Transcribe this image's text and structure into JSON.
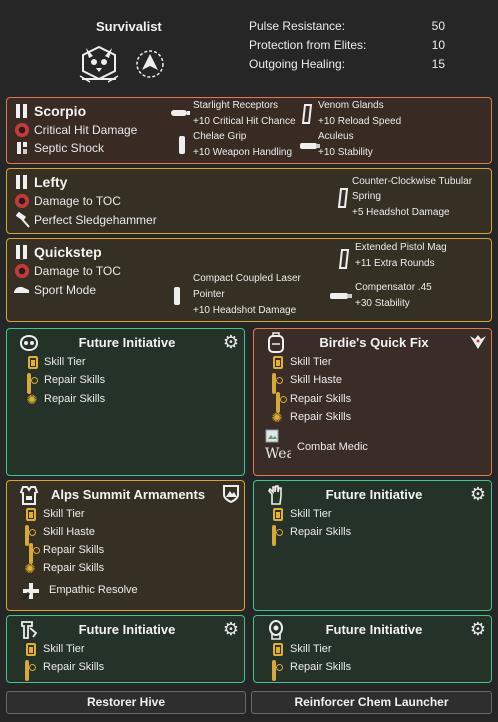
{
  "header": {
    "class_name": "Survivalist",
    "stats": [
      {
        "label": "Pulse Resistance:",
        "value": "50"
      },
      {
        "label": "Protection from Elites:",
        "value": "10"
      },
      {
        "label": "Outgoing Healing:",
        "value": "15"
      }
    ]
  },
  "weapons": [
    {
      "name": "Scorpio",
      "talents": [
        "Critical Hit Damage",
        "Septic Shock"
      ],
      "mods": [
        {
          "name": "Starlight Receptors",
          "bonus": "+10  Critical Hit Chance"
        },
        {
          "name": "Venom Glands",
          "bonus": "+10  Reload Speed"
        },
        {
          "name": "Chelae Grip",
          "bonus": "+10  Weapon Handling"
        },
        {
          "name": "Aculeus",
          "bonus": "+10  Stability"
        }
      ]
    },
    {
      "name": "Lefty",
      "talents": [
        "Damage to TOC",
        "Perfect Sledgehammer"
      ],
      "mods": [
        {
          "name": "Counter-Clockwise Tubular",
          "name2": "Spring",
          "bonus": "+5  Headshot Damage"
        }
      ]
    },
    {
      "name": "Quickstep",
      "talents": [
        "Damage to TOC",
        "Sport Mode"
      ],
      "mods": [
        {
          "name": "Extended Pistol Mag",
          "bonus": "+11  Extra Rounds"
        },
        {
          "name": "Compact Coupled Laser",
          "name2": "Pointer",
          "bonus": "+10  Headshot Damage"
        },
        {
          "name": "Compensator .45",
          "bonus": "+30  Stability"
        }
      ]
    }
  ],
  "gear": [
    {
      "title": "Future Initiative",
      "attrs": [
        "Skill Tier",
        "Repair Skills",
        "Repair Skills"
      ]
    },
    {
      "title": "Birdie's Quick Fix",
      "attrs": [
        "Skill Tier",
        "Skill Haste",
        "Repair Skills",
        "Repair Skills"
      ],
      "talent": "Combat Medic",
      "broken_img_alt": "Wea"
    },
    {
      "title": "Alps Summit Armaments",
      "attrs": [
        "Skill Tier",
        "Skill Haste",
        "Repair Skills",
        "Repair Skills"
      ],
      "talent": "Empathic Resolve"
    },
    {
      "title": "Future Initiative",
      "attrs": [
        "Skill Tier",
        "Repair Skills"
      ]
    },
    {
      "title": "Future Initiative",
      "attrs": [
        "Skill Tier",
        "Repair Skills"
      ]
    },
    {
      "title": "Future Initiative",
      "attrs": [
        "Skill Tier",
        "Repair Skills"
      ]
    }
  ],
  "skills": [
    "Restorer Hive",
    "Reinforcer Chem Launcher"
  ],
  "colors": {
    "background": "#262626",
    "high_end": "#e07a50",
    "exotic": "#d4a830",
    "gear_set": "#3cc88c"
  }
}
